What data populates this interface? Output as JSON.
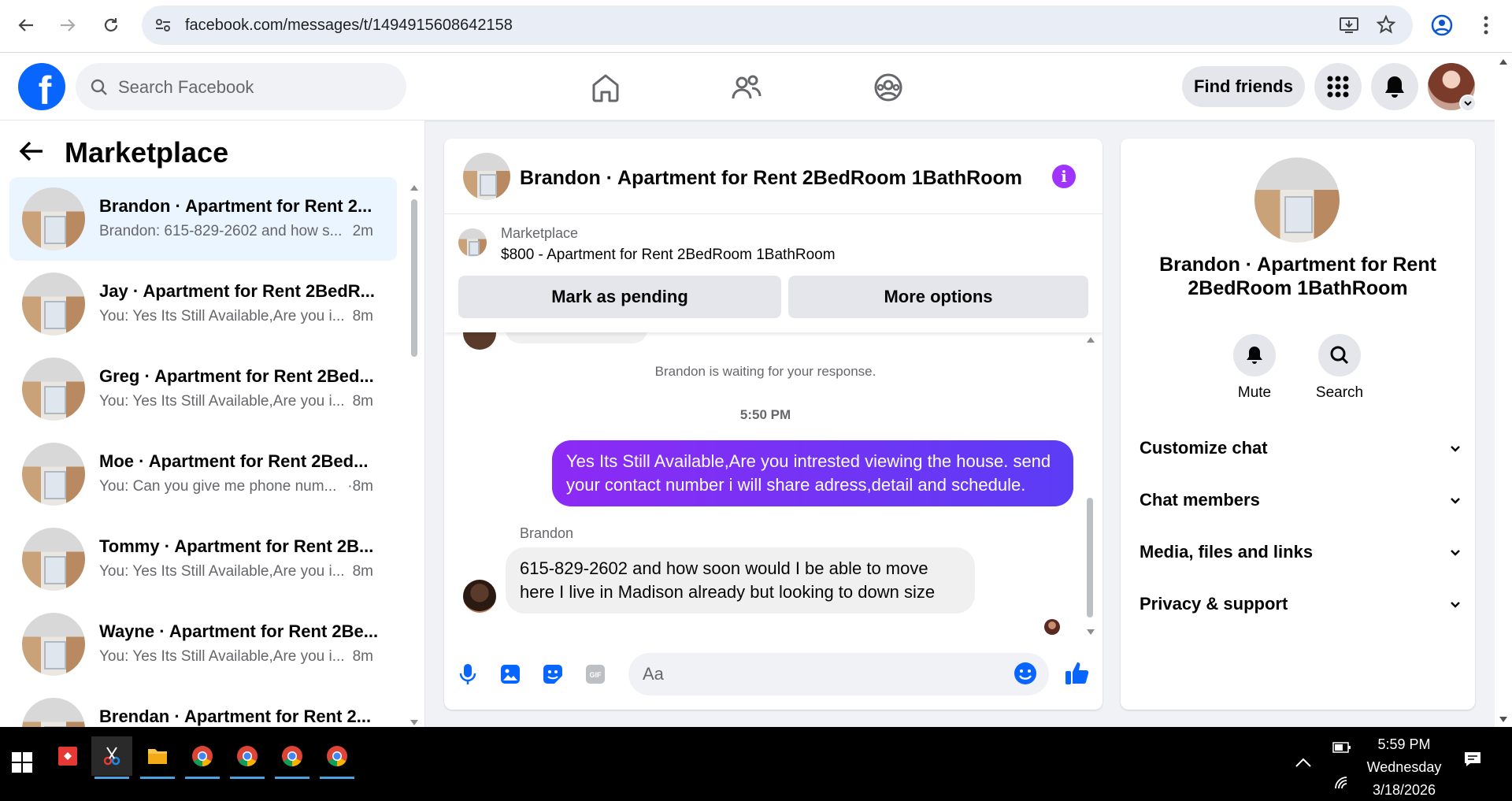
{
  "browser": {
    "url": "facebook.com/messages/t/1494915608642158"
  },
  "header": {
    "search_placeholder": "Search Facebook",
    "find_friends": "Find friends",
    "logo_letter": "f"
  },
  "left": {
    "title": "Marketplace",
    "threads": [
      {
        "name": "Brandon · Apartment for Rent 2...",
        "snippet": "Brandon: 615-829-2602 and how s...",
        "time": "2m",
        "active": true
      },
      {
        "name": "Jay · Apartment for Rent 2BedR...",
        "snippet": "You: Yes Its Still Available,Are you i...",
        "time": "8m"
      },
      {
        "name": "Greg · Apartment for Rent 2Bed...",
        "snippet": "You: Yes Its Still Available,Are you i...",
        "time": "8m"
      },
      {
        "name": "Moe · Apartment for Rent 2Bed...",
        "snippet": "You: Can you give me phone num...",
        "time": "·8m"
      },
      {
        "name": "Tommy · Apartment for Rent 2B...",
        "snippet": "You: Yes Its Still Available,Are you i...",
        "time": "8m"
      },
      {
        "name": "Wayne · Apartment for Rent 2Be...",
        "snippet": "You: Yes Its Still Available,Are you i...",
        "time": "8m"
      },
      {
        "name": "Brendan · Apartment for Rent 2...",
        "snippet": "",
        "time": ""
      }
    ]
  },
  "chat": {
    "title": "Brandon · Apartment for Rent 2BedRoom 1BathRoom",
    "info_glyph": "i",
    "marketplace_label": "Marketplace",
    "listing": "$800 - Apartment for Rent 2BedRoom 1BathRoom",
    "mark_pending": "Mark as pending",
    "more_options": "More options",
    "waiting": "Brandon is waiting for your response.",
    "timestamp": "5:50 PM",
    "outgoing": "Yes Its Still Available,Are you intrested viewing the house. send your contact number i will share adress,detail and schedule.",
    "sender": "Brandon",
    "incoming": "615-829-2602 and how soon would I be able to move here I live in Madison already but looking to down size",
    "composer_placeholder": "Aa"
  },
  "right": {
    "title": "Brandon · Apartment for Rent 2BedRoom 1BathRoom",
    "mute": "Mute",
    "search": "Search",
    "sections": [
      "Customize chat",
      "Chat members",
      "Media, files and links",
      "Privacy & support"
    ]
  },
  "taskbar": {
    "time": "5:59 PM",
    "day": "Wednesday",
    "date": "3/18/2026"
  }
}
